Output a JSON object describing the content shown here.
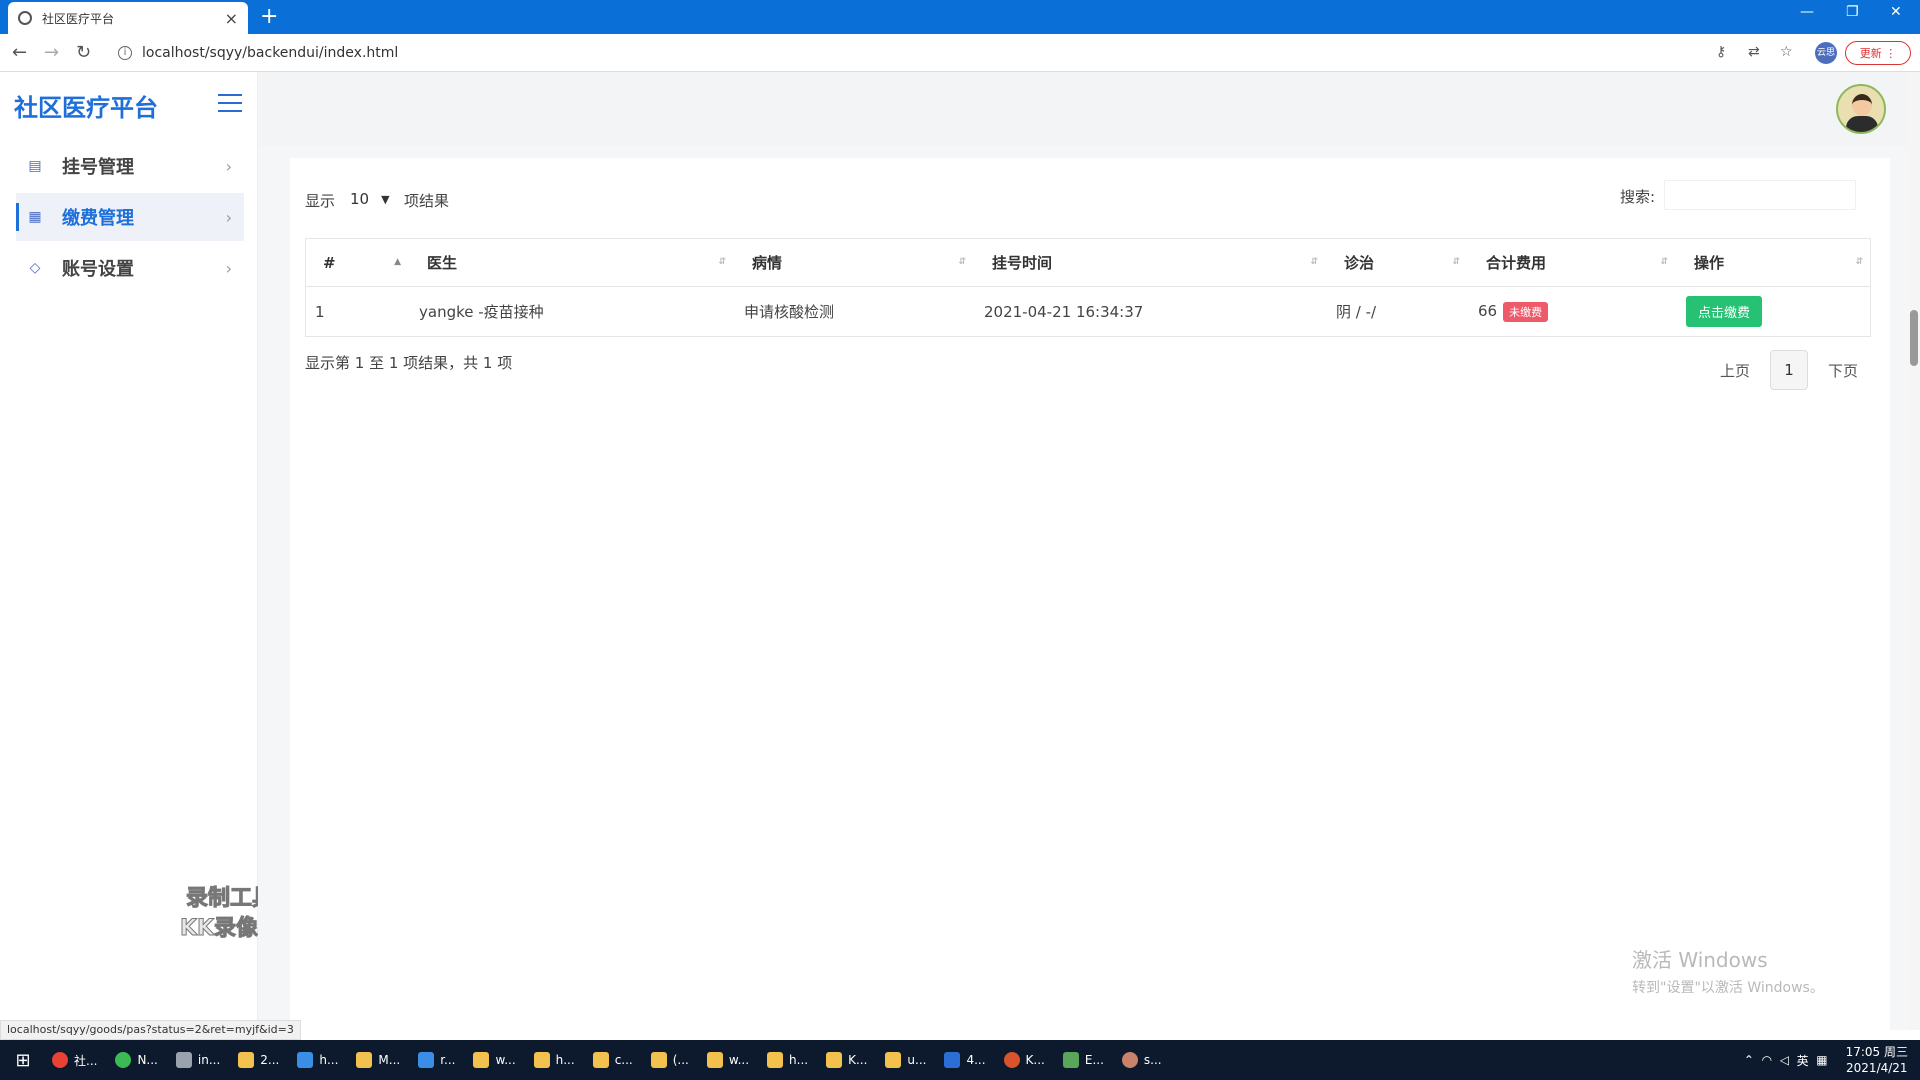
{
  "browser": {
    "tab_title": "社区医疗平台",
    "url": "localhost/sqyy/backendui/index.html",
    "profile_label": "云思",
    "update_label": "更新"
  },
  "app": {
    "brand": "社区医疗平台",
    "menu": [
      {
        "label": "挂号管理",
        "icon": "register-icon",
        "active": false
      },
      {
        "label": "缴费管理",
        "icon": "payment-icon",
        "active": true
      },
      {
        "label": "账号设置",
        "icon": "tag-icon",
        "active": false
      }
    ]
  },
  "table_controls": {
    "length_prefix": "显示",
    "length_value": "10",
    "length_suffix": "项结果",
    "search_label": "搜索:"
  },
  "table": {
    "columns": [
      "#",
      "医生",
      "病情",
      "挂号时间",
      "诊治",
      "合计费用",
      "操作"
    ],
    "rows": [
      {
        "num": "1",
        "doctor": "yangke -疫苗接种",
        "condition": "申请核酸检测",
        "time": "2021-04-21 16:34:37",
        "diagnosis": "阴 / -/",
        "fee": "66",
        "status": "未缴费",
        "action": "点击缴费"
      }
    ]
  },
  "footer": {
    "info": "显示第 1 至 1 项结果，共 1 项",
    "prev": "上页",
    "page": "1",
    "next": "下页"
  },
  "overlays": {
    "recorder_line1": "录制工具",
    "recorder_line2": "KK录像机",
    "activate_title": "激活 Windows",
    "activate_sub": "转到\"设置\"以激活 Windows。",
    "status_url": "localhost/sqyy/goods/pas?status=2&ret=myjf&id=3"
  },
  "taskbar": {
    "items": [
      "社...",
      "N...",
      "in...",
      "2...",
      "h...",
      "M...",
      "r...",
      "w...",
      "h...",
      "c...",
      "(...",
      "w...",
      "h...",
      "K...",
      "u...",
      "4...",
      "K...",
      "E...",
      "s..."
    ],
    "ime": "英",
    "time": "17:05 周三",
    "date": "2021/4/21"
  }
}
